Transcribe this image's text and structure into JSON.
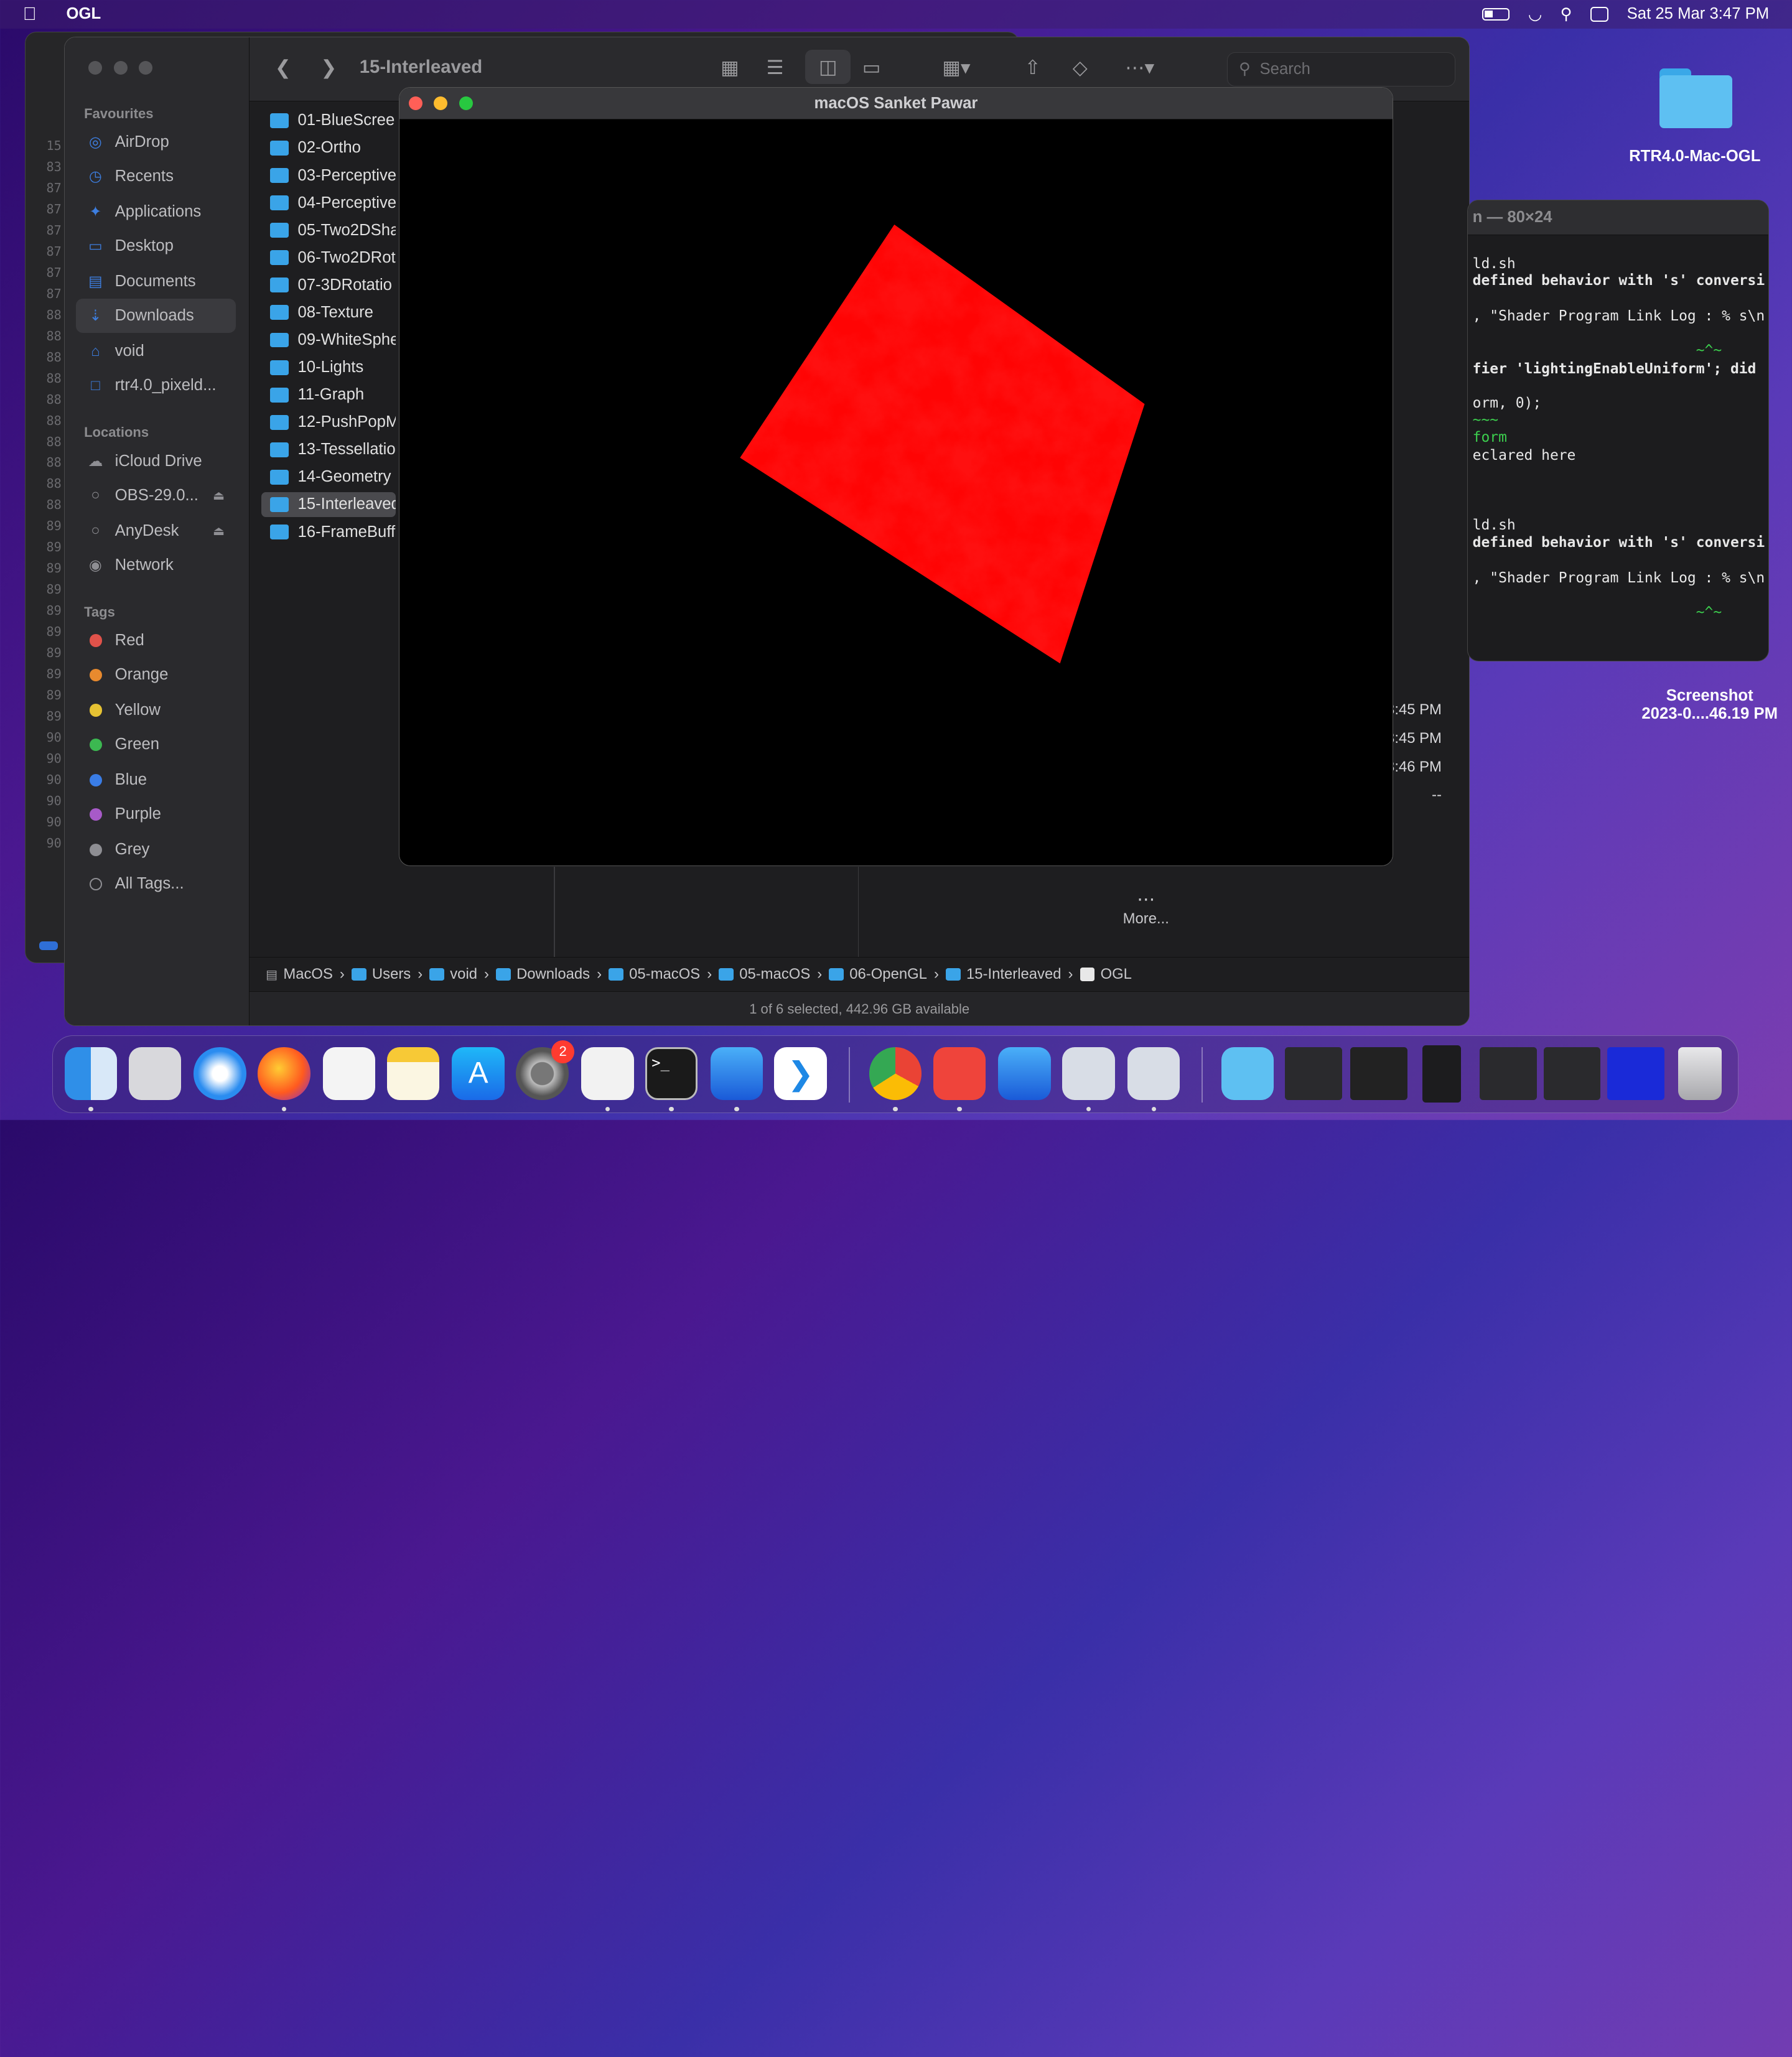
{
  "menubar": {
    "app_name": "OGL",
    "clock": "Sat 25 Mar  3:47 PM"
  },
  "finder": {
    "title": "15-Interleaved",
    "search_placeholder": "Search",
    "sidebar": {
      "favourites_heading": "Favourites",
      "favourites": [
        {
          "label": "AirDrop",
          "icon": "airdrop-icon"
        },
        {
          "label": "Recents",
          "icon": "clock-icon"
        },
        {
          "label": "Applications",
          "icon": "applications-icon"
        },
        {
          "label": "Desktop",
          "icon": "desktop-icon"
        },
        {
          "label": "Documents",
          "icon": "document-icon"
        },
        {
          "label": "Downloads",
          "icon": "download-icon"
        },
        {
          "label": "void",
          "icon": "home-icon"
        },
        {
          "label": "rtr4.0_pixeld...",
          "icon": "folder-icon"
        }
      ],
      "locations_heading": "Locations",
      "locations": [
        {
          "label": "iCloud Drive",
          "icon": "cloud-icon"
        },
        {
          "label": "OBS-29.0...",
          "icon": "disk-icon"
        },
        {
          "label": "AnyDesk",
          "icon": "disk-icon"
        },
        {
          "label": "Network",
          "icon": "globe-icon"
        }
      ],
      "tags_heading": "Tags",
      "tags": [
        {
          "label": "Red",
          "color": "#e0524a"
        },
        {
          "label": "Orange",
          "color": "#e88a2e"
        },
        {
          "label": "Yellow",
          "color": "#e6c233"
        },
        {
          "label": "Green",
          "color": "#3cb851"
        },
        {
          "label": "Blue",
          "color": "#3a7de6"
        },
        {
          "label": "Purple",
          "color": "#a75ac8"
        },
        {
          "label": "Grey",
          "color": "#8e8e93"
        },
        {
          "label": "All Tags...",
          "color": ""
        }
      ]
    },
    "folders": [
      "01-BlueScree",
      "02-Ortho",
      "03-Perceptive",
      "04-Perceptive",
      "05-Two2DSha",
      "06-Two2DRot",
      "07-3DRotatio",
      "08-Texture",
      "09-WhiteSphe",
      "10-Lights",
      "11-Graph",
      "12-PushPopM",
      "13-Tessellatio",
      "14-Geometry",
      "15-Interleaved",
      "16-FrameBuff"
    ],
    "times": [
      "3:45 PM",
      "3:45 PM",
      "3:46 PM",
      "--"
    ],
    "more_label": "More...",
    "path": [
      "MacOS",
      "Users",
      "void",
      "Downloads",
      "05-macOS",
      "05-macOS",
      "06-OpenGL",
      "15-Interleaved",
      "OGL"
    ],
    "status": "1 of 6 selected, 442.96 GB available"
  },
  "ogl_window": {
    "title": "macOS Sanket Pawar",
    "accent": "#ff0000"
  },
  "terminal": {
    "title": "n — 80×24",
    "lines": [
      {
        "text": "ld.sh",
        "style": ""
      },
      {
        "text": "defined behavior with 's' conversi",
        "style": "b"
      },
      {
        "text": ", \"Shader Program Link Log : % s\\n",
        "style": ""
      },
      {
        "text": "                          ~^~",
        "style": "g"
      },
      {
        "text": "fier 'lightingEnableUniform'; did",
        "style": "b"
      },
      {
        "text": "orm, 0);",
        "style": ""
      },
      {
        "text": "~~~",
        "style": "g"
      },
      {
        "text": "form",
        "style": "g"
      },
      {
        "text": "eclared here",
        "style": ""
      },
      {
        "text": "ld.sh",
        "style": ""
      },
      {
        "text": "defined behavior with 's' conversi",
        "style": "b"
      },
      {
        "text": ", \"Shader Program Link Log : % s\\n M",
        "style": ""
      },
      {
        "text": "                          ~^~",
        "style": "g"
      }
    ]
  },
  "desktop": {
    "folder_label": "RTR4.0-Mac-OGL",
    "screenshot_label_1": "Screenshot",
    "screenshot_label_2": "2023-0....46.19 PM"
  },
  "dock": {
    "badge_count": "2",
    "apps": [
      "finder-icon",
      "launchpad-icon",
      "safari-icon",
      "firefox-icon",
      "reminders-icon",
      "notes-icon",
      "app-store-icon",
      "system-settings-icon",
      "textedit-icon",
      "terminal-icon",
      "xcode-icon",
      "vscode-icon",
      "chrome-icon",
      "anydesk-icon",
      "xcode-instruments-icon",
      "preview-icon",
      "preview-icon-2",
      "downloads-stack-icon",
      "window-thumb-icon",
      "window-thumb-icon",
      "window-thumb-icon",
      "window-thumb-icon",
      "window-thumb-icon",
      "window-thumb-icon",
      "trash-icon"
    ]
  }
}
